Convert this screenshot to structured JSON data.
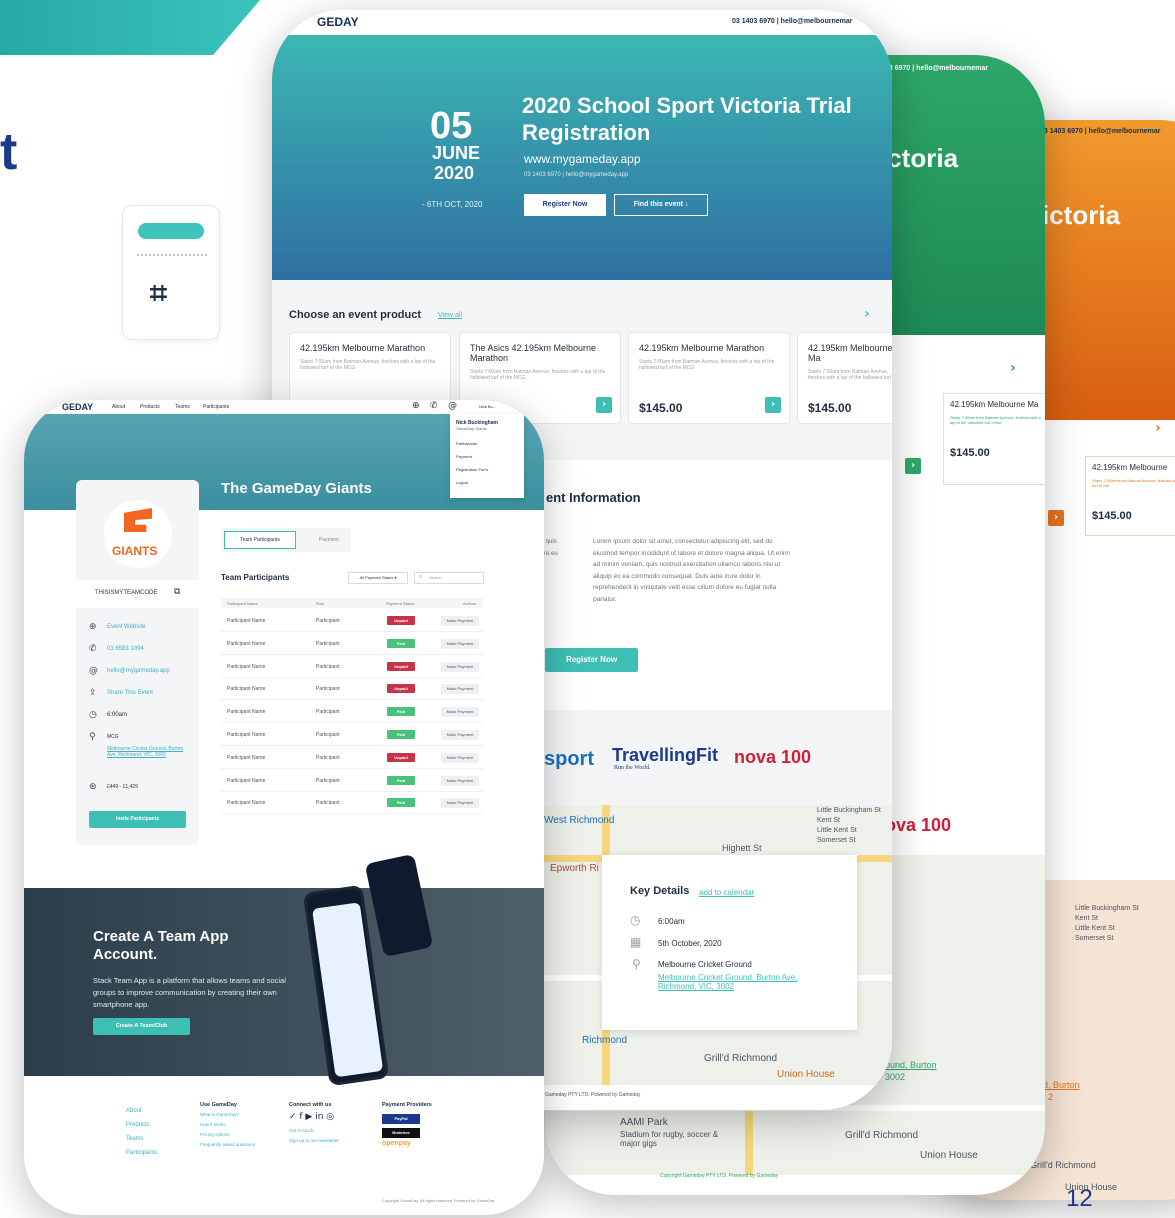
{
  "slide_number": "12",
  "corner_text": "t",
  "sheet_back": {
    "contact": "03 1403 6970 | hello@melbournemar",
    "hero_title": "ictoria",
    "card_title": "42.195km Melbourne",
    "card_desc": "Starts 7:00am from Batman Avenue, finishes with a lap of the hallowed turf of the",
    "price": "$145.00",
    "map_label_1": "Little Buckingham St",
    "map_label_2": "Kent St",
    "map_label_3": "Little Kent St",
    "map_label_4": "Somerset St",
    "address_tail": "nd, Burton",
    "address_tail_2": "Boy 2",
    "place": "Grill'd Richmond",
    "place_2": "Union House",
    "copyright": "Copyright Gameday PTY LTD. Powered by Gameday"
  },
  "sheet_green": {
    "contact": "03 6970 | hello@melbournemar",
    "hero_title": "ictoria",
    "card_title": "42.195km Melbourne Ma",
    "card_desc": "Starts 7:00am from Batman Avenue, finishes with a lap of the hallowed turf of the",
    "price": "$145.00",
    "brand_tail": "ova 100",
    "address_tail": "ound, Burton",
    "address_tail_2": "3002",
    "place": "Grill'd Richmond",
    "place_2": "Union House",
    "place_3": "AAMI Park",
    "place_3_sub": "Stadium for rugby, soccer & major gigs",
    "copyright": "Copyright Gameday PTY LTD. Powered by Gameday"
  },
  "sheet_main": {
    "logo": "GEDAY",
    "contact": "03 1403 6970 | hello@melbournemar",
    "date_day": "05",
    "date_month": "JUNE",
    "date_year": "2020",
    "date_end": "- 6TH OCT, 2020",
    "title": "2020 School Sport Victoria Trial Registration",
    "url": "www.mygameday.app",
    "sub_contact": "03 1403 6970 | hello@mygameday.app",
    "register_btn": "Register Now",
    "find_btn": "Find this event ↓",
    "choose_heading": "Choose an event product",
    "view_all": "View all",
    "products": [
      {
        "title": "42.195km Melbourne Marathon",
        "desc": "Starts 7:00am from Batman Avenue, finishes with a lap of the hallowed turf of the MCG",
        "price": "$145.00"
      },
      {
        "title": "The Asics 42.195km Melbourne Marathon",
        "desc": "Starts 7:00am from Batman Avenue, finishes with a lap of the hallowed turf of the MCG",
        "price": "$145.00"
      },
      {
        "title": "42.195km Melbourne Marathon",
        "desc": "Starts 7:00am from Batman Avenue, finishes with a lap of the hallowed turf of the MCG",
        "price": "$145.00"
      },
      {
        "title": "42.195km Melbourne Ma",
        "desc": "Starts 7:00am from Batman Avenue, finishes with a lap of the hallowed turf of the",
        "price": "$145.00"
      }
    ],
    "event_info_heading": "ent Information",
    "lorem": "Lorem ipsum dolor sit amet, consectetur adipiscing elit, sed do eiusmod tempor incididunt ut labore et dolore magna aliqua. Ut enim ad minim veniam, quis nostrud exercitation ullamco laboris nisi ut aliquip ex ea commodo consequat. Duis aute irure dolor in reprehenderit in voluptate velit esse cillum dolore eu fugiat nulla pariatur.",
    "lorem_left": "cing e et , quis uip ex ea re eu",
    "register_btn_2": "Register Now",
    "sponsors": [
      "sport",
      "TravellingFit",
      "nova 100"
    ],
    "sponsor_sub": "Run the World.",
    "key_details": "Key Details",
    "add_calendar": "add to calendar",
    "time": "6:00am",
    "date": "5th October, 2020",
    "venue": "Melbourne Cricket Ground",
    "venue_address": "Melbourne Cricket Ground, Burton Ave, Richmond, VIC, 3002",
    "map_labels": [
      "West Richmond",
      "Epworth Ri",
      "Highett St",
      "Richmond",
      "Grill'd Richmond",
      "Union House",
      "Little Buckingham St",
      "Kent St",
      "Little Kent St",
      "Somerset St"
    ],
    "footer": "Gameday PTY LTD. Powered by Gameday"
  },
  "sheet_giants": {
    "logo": "GEDAY",
    "nav": [
      "About",
      "Products",
      "Teams",
      "Participants"
    ],
    "user": "Nick Bu...",
    "menu_user": "Nick Buckingham",
    "menu_team": "GameDay Giants",
    "menu_items": [
      "Participants",
      "Payment",
      "Registration Form",
      "Logout"
    ],
    "team_title": "The GameDay Giants",
    "club_logo_text": "GIANTS",
    "team_code": "THISISMYTEAMCODE",
    "side": [
      {
        "icon": "globe-icon",
        "label": "Event Website"
      },
      {
        "icon": "phone-icon",
        "label": "03 6583 1094"
      },
      {
        "icon": "at-icon",
        "label": "hello@mygameday.app"
      },
      {
        "icon": "share-icon",
        "label": "Share This Event"
      },
      {
        "icon": "clock-icon",
        "label": "6:00am"
      },
      {
        "icon": "pin-icon",
        "label": "MCG"
      },
      {
        "icon": "price-icon",
        "label": "£449 - £1,429"
      }
    ],
    "venue_link": "Melbourne Cricket Ground, Burton Ave, Richmond, VIC, 3002",
    "invite_btn": "Invite Participants",
    "tabs": [
      "Team Participants",
      "Payment"
    ],
    "participants_heading": "Team Participants",
    "filter": "All Payment Status ▾",
    "search_placeholder": "Search",
    "columns": [
      "Participant Name",
      "Role",
      "Payment Status",
      "Actions"
    ],
    "rows": [
      {
        "name": "Participant Name",
        "role": "Participant",
        "status": "Unpaid",
        "action": "Make Payment"
      },
      {
        "name": "Participant Name",
        "role": "Participant",
        "status": "Paid",
        "action": "Make Payment"
      },
      {
        "name": "Participant Name",
        "role": "Participant",
        "status": "Unpaid",
        "action": "Make Payment"
      },
      {
        "name": "Participant Name",
        "role": "Participant",
        "status": "Unpaid",
        "action": "Make Payment"
      },
      {
        "name": "Participant Name",
        "role": "Participant",
        "status": "Paid",
        "action": "Make Payment"
      },
      {
        "name": "Participant Name",
        "role": "Participant",
        "status": "Paid",
        "action": "Make Payment"
      },
      {
        "name": "Participant Name",
        "role": "Participant",
        "status": "Unpaid",
        "action": "Make Payment"
      },
      {
        "name": "Participant Name",
        "role": "Participant",
        "status": "Paid",
        "action": "Make Payment"
      },
      {
        "name": "Participant Name",
        "role": "Participant",
        "status": "Paid",
        "action": "Make Payment"
      }
    ],
    "promo_title": "Create A Team App Account.",
    "promo_text": "Stack Team App is a platform that allows teams and social groups to improve communication by creating their own smartphone app.",
    "promo_btn": "Create A Team/Club",
    "footer_col1": [
      "About",
      "Products",
      "Teams",
      "Participants"
    ],
    "footer_col2_title": "Use GameDay",
    "footer_col2": [
      "What is GameDay?",
      "How it works",
      "Pricing options",
      "Frequently asked questions"
    ],
    "footer_col3_title": "Connect with us",
    "footer_col3": [
      "Get in touch",
      "Sign up to our newsletter"
    ],
    "footer_col4_title": "Payment Providers",
    "payment_providers": [
      "PayPal",
      "Braintree",
      "openpay"
    ],
    "copyright": "Copyright GameDay. All rights reserved. Powered by GameDay"
  },
  "colors": {
    "teal": "#3ebfb6",
    "navy": "#1c3a8a",
    "orange": "#e8721a",
    "green": "#2ea76a",
    "unpaid": "#c8334a",
    "paid": "#48c27a"
  }
}
